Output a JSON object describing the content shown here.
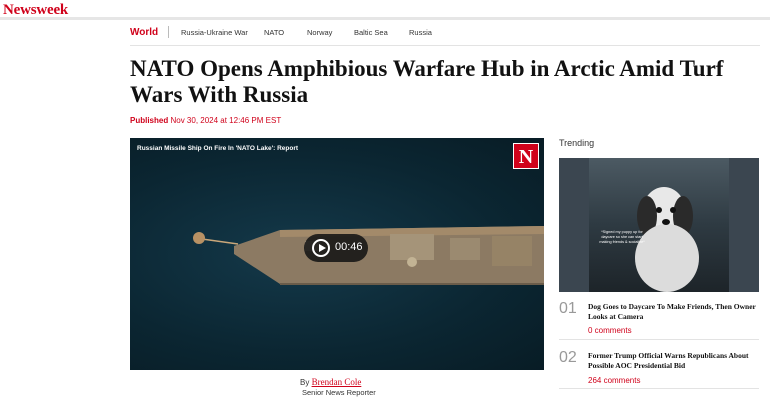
{
  "brand": {
    "logo": "Newsweek",
    "accent_color": "#d0021b"
  },
  "nav": {
    "category": "World",
    "items": [
      "Russia-Ukraine War",
      "NATO",
      "Norway",
      "Baltic Sea",
      "Russia"
    ]
  },
  "article": {
    "headline_line1": "NATO Opens Amphibious Warfare Hub in Arctic Amid Turf",
    "headline_line2": "Wars With Russia",
    "published_label": "Published",
    "published_date": "Nov 30, 2024 at 12:46 PM EST",
    "byline_prefix": "By",
    "author": "Brendan Cole",
    "author_role": "Senior News Reporter"
  },
  "video": {
    "title": "Russian Missile Ship On Fire In 'NATO Lake': Report",
    "brand_letter": "N",
    "duration": "00:46",
    "play_icon": "play-circle-icon"
  },
  "trending": {
    "title": "Trending",
    "image_caption": "*Signed my puppy up for daycare so she can start making friends & socialize*",
    "items": [
      {
        "num": "01",
        "title": "Dog Goes to Daycare To Make Friends, Then Owner Looks at Camera",
        "comments": "0 comments"
      },
      {
        "num": "02",
        "title": "Former Trump Official Warns Republicans About Possible AOC Presidential Bid",
        "comments": "264 comments"
      }
    ]
  }
}
